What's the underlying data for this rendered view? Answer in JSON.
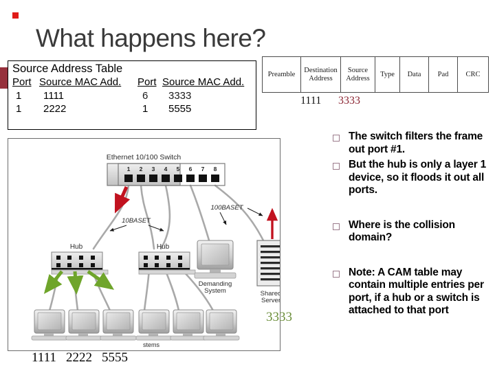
{
  "slide": {
    "title": "What happens here?",
    "accent_red": "#96313C",
    "bullet_dot_color": "#E01B18"
  },
  "source_address_table": {
    "title": "Source Address Table",
    "headers": [
      "Port",
      "Source MAC Add.",
      "Port",
      "Source MAC Add."
    ],
    "rows": [
      {
        "port_left": "1",
        "mac_left": "1111",
        "port_right": "6",
        "mac_right": "3333"
      },
      {
        "port_left": "1",
        "mac_left": "2222",
        "port_right": "1",
        "mac_right": "5555"
      }
    ]
  },
  "ethernet_frame": {
    "fields": [
      "Preamble",
      "Destination Address",
      "Source Address",
      "Type",
      "Data",
      "Pad",
      "CRC"
    ],
    "destination_value": "1111",
    "source_value": "3333",
    "destination_color": "#111111",
    "source_color": "#8B2532"
  },
  "bullets": [
    {
      "text": "The switch filters the frame out port #1."
    },
    {
      "text": "But the hub is only a layer 1 device, so it floods it out all ports."
    },
    {
      "text": "Where is the collision domain?"
    },
    {
      "text": "Note: A CAM table may contain multiple entries per port, if a hub or a switch is attached to that port"
    }
  ],
  "network_diagram": {
    "switch_caption": "Ethernet 10/100 Switch",
    "switch_ports": [
      "1",
      "2",
      "3",
      "4",
      "5",
      "6",
      "7",
      "8"
    ],
    "hub_left_caption": "Hub",
    "hub_right_caption": "Hub",
    "link_label_10baset": "10BASET",
    "link_label_100baset": "100BASET",
    "demanding_system_caption_line1": "Demanding",
    "demanding_system_caption_line2": "System",
    "shared_server_caption_line1": "Shared",
    "shared_server_caption_line2": "Server",
    "stray_caption": "stems",
    "host_macs": [
      "1111",
      "2222",
      "5555"
    ],
    "server_mac": "3333",
    "server_mac_color": "#6B8E3A",
    "incoming_arrow_color": "#C1121F",
    "flood_arrow_color": "#6FA52B"
  }
}
